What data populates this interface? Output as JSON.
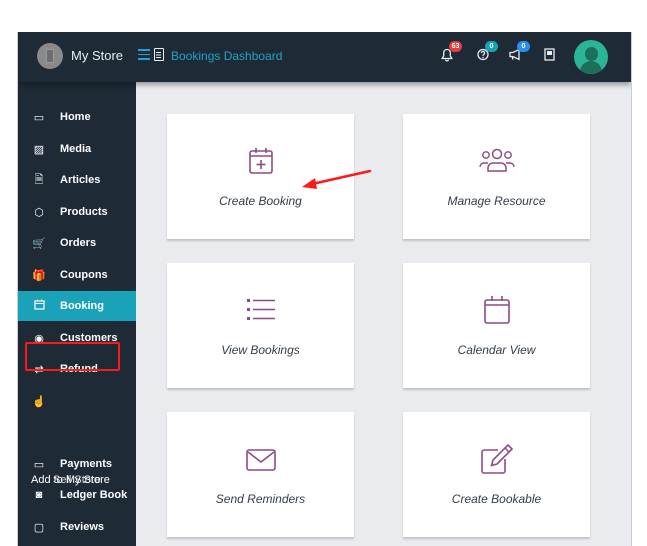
{
  "topbar": {
    "store_name": "My Store",
    "page_title": "Bookings Dashboard",
    "notifications": {
      "icon": "bell-icon",
      "count": "63",
      "color": "#e53e3e"
    },
    "help": {
      "icon": "question-circle-icon",
      "count": "0",
      "color": "#1aa3b8"
    },
    "announcements": {
      "icon": "megaphone-icon",
      "count": "0",
      "color": "#2b8ef0"
    },
    "knowledgebase": {
      "icon": "book-icon"
    },
    "profile": {
      "icon": "user-avatar-icon"
    }
  },
  "sidebar": {
    "items": [
      {
        "label": "Home",
        "icon": "monitor-icon"
      },
      {
        "label": "Media",
        "icon": "image-icon"
      },
      {
        "label": "Articles",
        "icon": "document-icon"
      },
      {
        "label": "Products",
        "icon": "cube-icon"
      },
      {
        "label": "Orders",
        "icon": "cart-icon"
      },
      {
        "label": "Coupons",
        "icon": "gift-icon"
      },
      {
        "label": "Booking",
        "icon": "calendar-icon",
        "active": true
      },
      {
        "label": "Customers",
        "icon": "user-circle-icon"
      },
      {
        "label": "Refund",
        "icon": "refund-icon"
      },
      {
        "label": "",
        "icon": "hand-pointer-icon"
      },
      {
        "label": "Add to My Store",
        "overlap_label": "Sell Store",
        "icon": "store-icon"
      },
      {
        "label": "Payments",
        "icon": "credit-card-icon"
      },
      {
        "label": "Ledger Book",
        "icon": "money-icon"
      },
      {
        "label": "Reviews",
        "icon": "comment-icon"
      }
    ]
  },
  "cards": [
    {
      "label": "Create Booking",
      "icon": "calendar-plus-icon"
    },
    {
      "label": "Manage Resource",
      "icon": "users-icon"
    },
    {
      "label": "View Bookings",
      "icon": "list-icon"
    },
    {
      "label": "Calendar View",
      "icon": "calendar-icon"
    },
    {
      "label": "Send Reminders",
      "icon": "envelope-icon"
    },
    {
      "label": "Create Bookable",
      "icon": "edit-icon"
    }
  ],
  "colors": {
    "accent": "#1aa3b8",
    "icon_purple": "#8e4a87",
    "annotation_red": "#ff1a1a"
  }
}
